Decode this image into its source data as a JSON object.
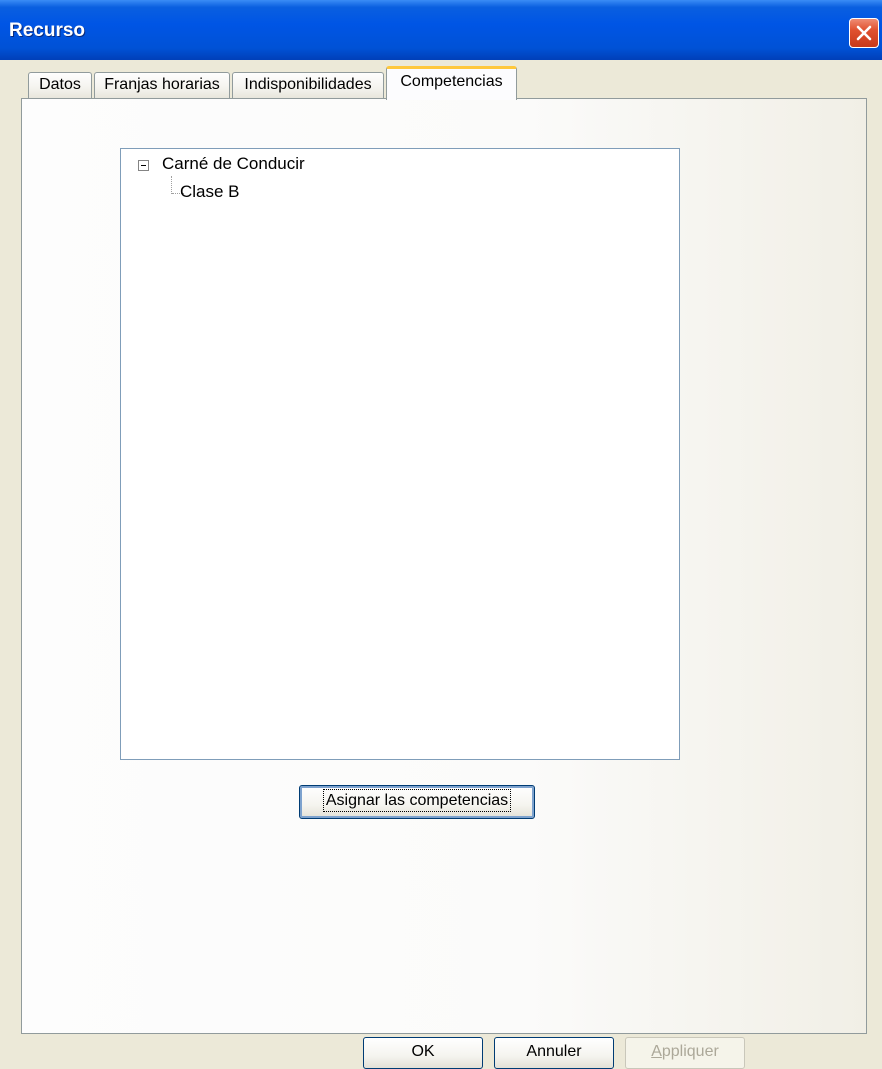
{
  "window": {
    "title": "Recurso"
  },
  "tabs": [
    {
      "label": "Datos"
    },
    {
      "label": "Franjas horarias"
    },
    {
      "label": "Indisponibilidades"
    },
    {
      "label": "Competencias",
      "active": true
    }
  ],
  "tree": {
    "root": {
      "label": "Carné de Conducir",
      "expanded": true
    },
    "children": [
      {
        "label": "Clase B"
      }
    ]
  },
  "assign_button": {
    "label": "Asignar las competencias"
  },
  "footer": {
    "ok_label": "OK",
    "cancel_label": "Annuler",
    "apply_label_first": "A",
    "apply_label_rest": "ppliquer",
    "apply_enabled": false
  },
  "colors": {
    "title_bar": "#0055e5",
    "dialog_bg": "#ece9d8",
    "active_tab_accent": "#ffc83c",
    "close_button": "#e0512f"
  }
}
